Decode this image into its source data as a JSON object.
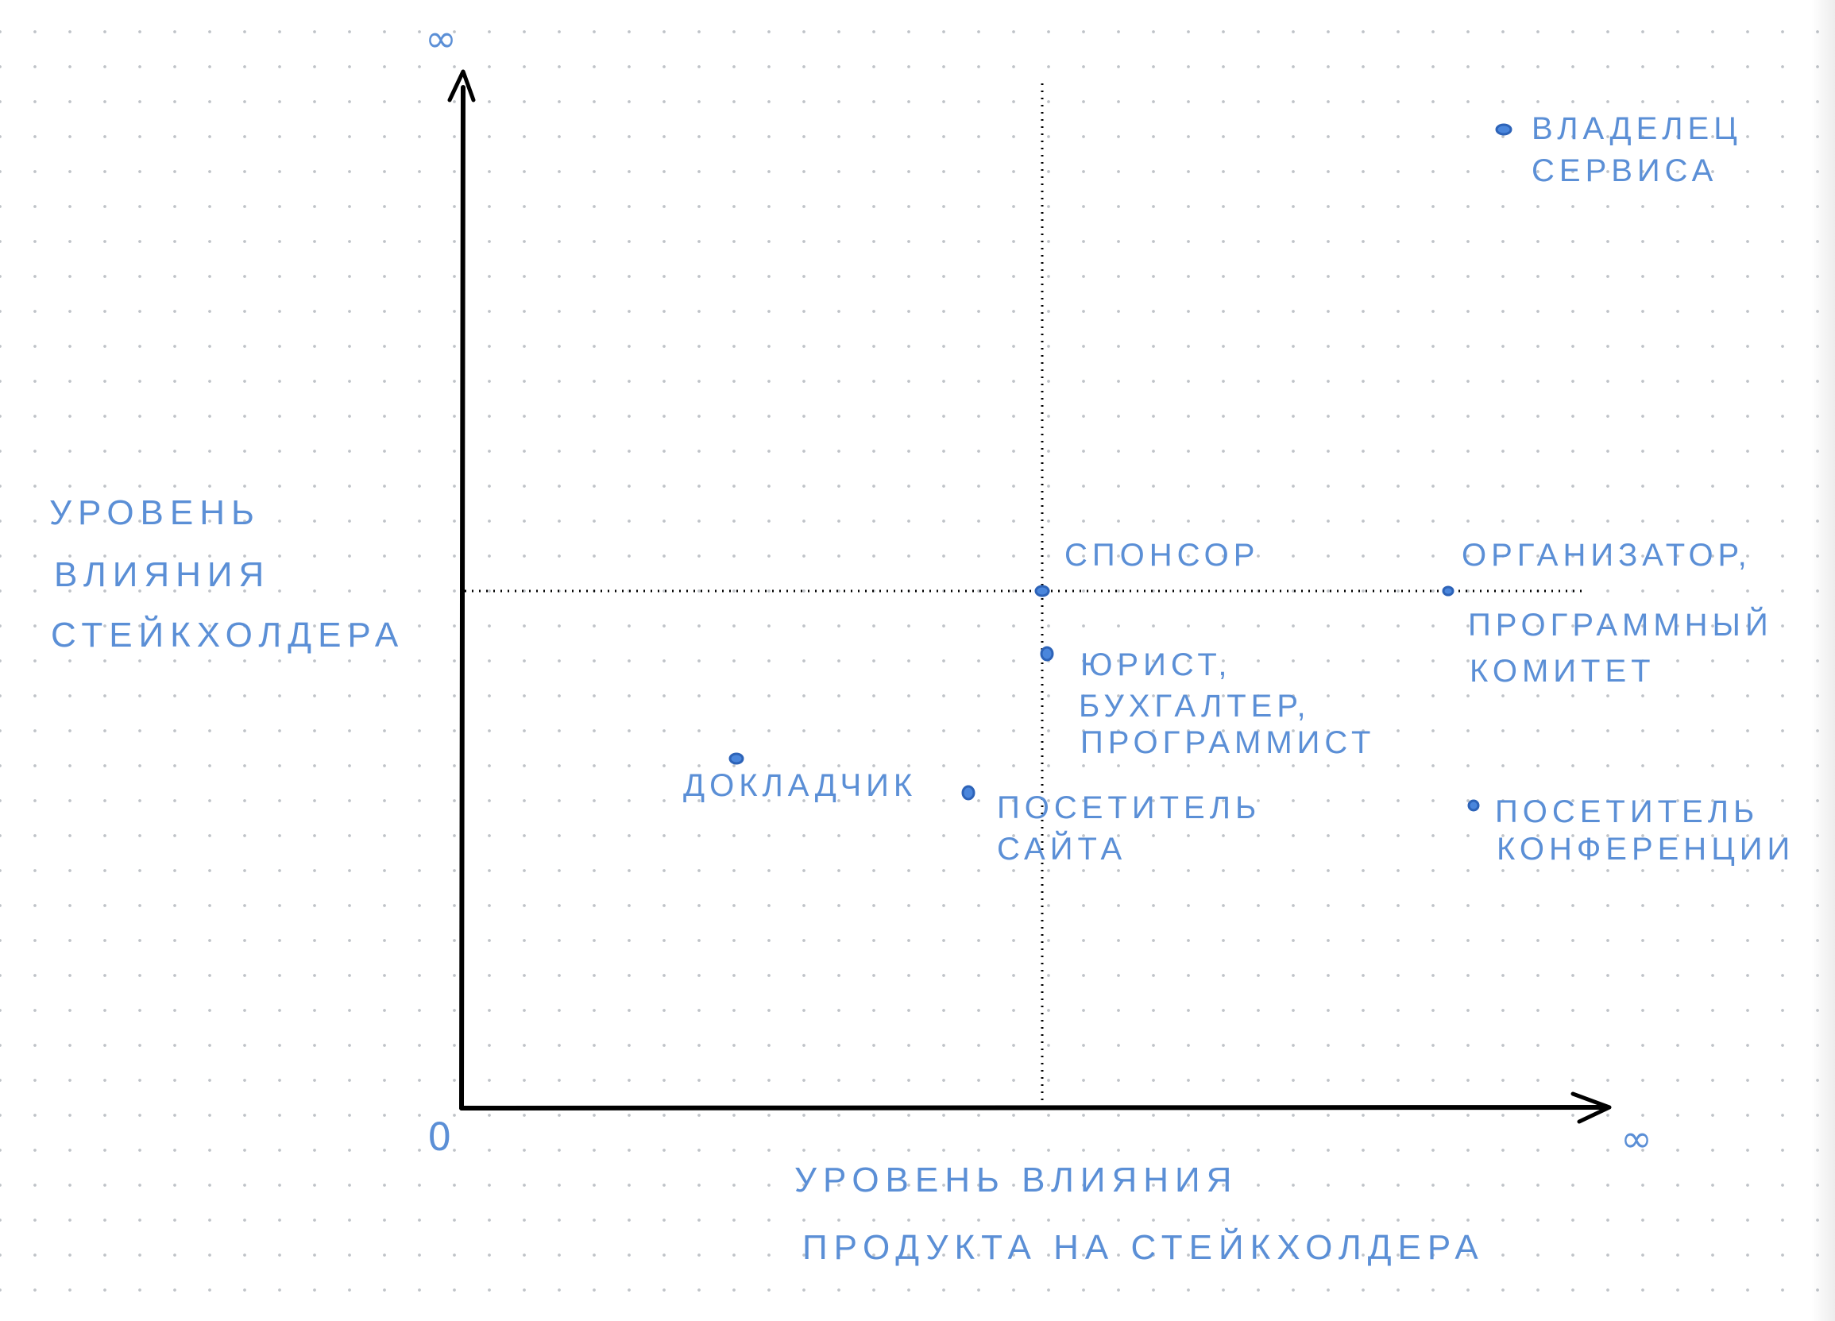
{
  "diagram": {
    "origin_label": "0",
    "y_infinity": "∞",
    "x_infinity": "∞",
    "y_axis_label": [
      "УРОВЕНЬ",
      "ВЛИЯНИЯ",
      "СТЕЙКХОЛДЕРА"
    ],
    "x_axis_label": [
      "УРОВЕНЬ ВЛИЯНИЯ",
      "ПРОДУКТА НА СТЕЙКХОЛДЕРА"
    ],
    "stakeholders": [
      {
        "id": "owner",
        "lines": [
          "ВЛАДЕЛЕЦ",
          "СЕРВИСА"
        ]
      },
      {
        "id": "sponsor",
        "lines": [
          "СПОНСОР"
        ]
      },
      {
        "id": "organizer",
        "lines": [
          "ОРГАНИЗАТОР,",
          "ПРОГРАММНЫЙ",
          "КОМИТЕТ"
        ]
      },
      {
        "id": "staff",
        "lines": [
          "ЮРИСТ,",
          "БУХГАЛТЕР,",
          "ПРОГРАММИСТ"
        ]
      },
      {
        "id": "speaker",
        "lines": [
          "ДОКЛАДЧИК"
        ]
      },
      {
        "id": "site-visitor",
        "lines": [
          "ПОСЕТИТЕЛЬ",
          "САЙТА"
        ]
      },
      {
        "id": "conference-visitor",
        "lines": [
          "ПОСЕТИТЕЛЬ",
          "КОНФЕРЕНЦИИ"
        ]
      }
    ],
    "colors": {
      "ink": "#000000",
      "marker": "#5b8fd6",
      "dot_grid": "#bfc3c8"
    }
  }
}
